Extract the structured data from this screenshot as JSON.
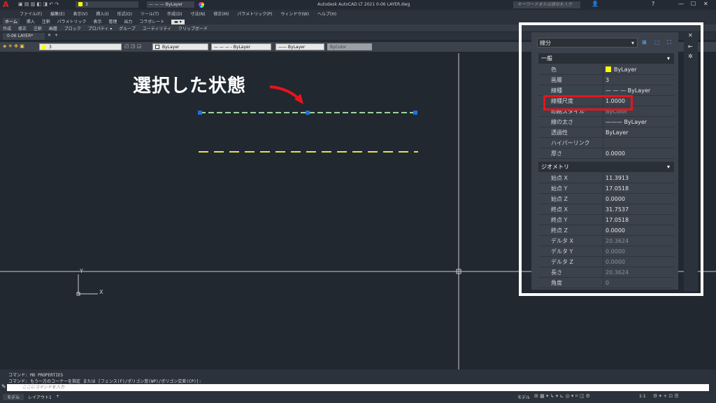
{
  "app": {
    "window_title": "Autodesk AutoCAD LT 2021    0-06 LAYER.dwg",
    "search_placeholder": "キーワードまたは語句を入力"
  },
  "menu": [
    "ファイル(F)",
    "編集(E)",
    "表示(V)",
    "挿入(I)",
    "形式(O)",
    "ツール(T)",
    "作成(D)",
    "寸法(N)",
    "修正(M)",
    "パラメトリック(P)",
    "ウィンドウ(W)",
    "ヘルプ(H)"
  ],
  "ribbon_tabs": [
    "ホーム",
    "挿入",
    "注釈",
    "パラメトリック",
    "表示",
    "管理",
    "出力",
    "コラボレート"
  ],
  "ribbon_panels": [
    "作成",
    "修正",
    "注釈",
    "画層",
    "ブロック",
    "プロパティ ▾",
    "グループ",
    "ユーティリティ",
    "クリップボード"
  ],
  "doc_tab": "0-06 LAYER*",
  "qat": {
    "layer": "3",
    "linetype": "— — —  ByLayer"
  },
  "toolbar": {
    "layer_value": "3",
    "color_value": "ByLayer",
    "linetype_value": "— — —  - ByLayer",
    "lineweight_value": "—— ByLayer",
    "plotstyle_value": "ByColor"
  },
  "annotation": {
    "text": "選択した状態"
  },
  "properties": {
    "object_type": "線分",
    "general": {
      "title": "一般",
      "rows": [
        {
          "key": "色",
          "value": "ByLayer"
        },
        {
          "key": "画層",
          "value": "3"
        },
        {
          "key": "線種",
          "value": "— — —  ByLayer"
        },
        {
          "key": "線種尺度",
          "value": "1.0000"
        },
        {
          "key": "印刷スタイル",
          "value": "ByColor"
        },
        {
          "key": "線の太さ",
          "value": "———  ByLayer"
        },
        {
          "key": "透過性",
          "value": "ByLayer"
        },
        {
          "key": "ハイパーリンク",
          "value": ""
        },
        {
          "key": "厚さ",
          "value": "0.0000"
        }
      ]
    },
    "geometry": {
      "title": "ジオメトリ",
      "rows": [
        {
          "key": "始点 X",
          "value": "11.3913"
        },
        {
          "key": "始点 Y",
          "value": "17.0518"
        },
        {
          "key": "始点 Z",
          "value": "0.0000"
        },
        {
          "key": "終点 X",
          "value": "31.7537"
        },
        {
          "key": "終点 Y",
          "value": "17.0518"
        },
        {
          "key": "終点 Z",
          "value": "0.0000"
        },
        {
          "key": "デルタ X",
          "value": "20.3624"
        },
        {
          "key": "デルタ Y",
          "value": "0.0000"
        },
        {
          "key": "デルタ Z",
          "value": "0.0000"
        },
        {
          "key": "長さ",
          "value": "20.3624"
        },
        {
          "key": "角度",
          "value": "0"
        }
      ]
    }
  },
  "command": {
    "history1": "コマンド: MO PROPERTIES",
    "history2": "コマンド: もう一方のコーナーを指定 または [フェンス(F)/ポリゴン窓(WP)/ポリゴン交差(CP)]:",
    "prompt_placeholder": "ここにコマンドを入力"
  },
  "layout_tabs": [
    "モデル",
    "レイアウト1"
  ],
  "status": {
    "model": "モデル",
    "scale": "1:1"
  },
  "colors": {
    "highlight_red": "#e8141b",
    "line_yellow": "#e6e04a",
    "selected_line_green": "#9ed39a",
    "grip_blue": "#1f6fe0"
  }
}
